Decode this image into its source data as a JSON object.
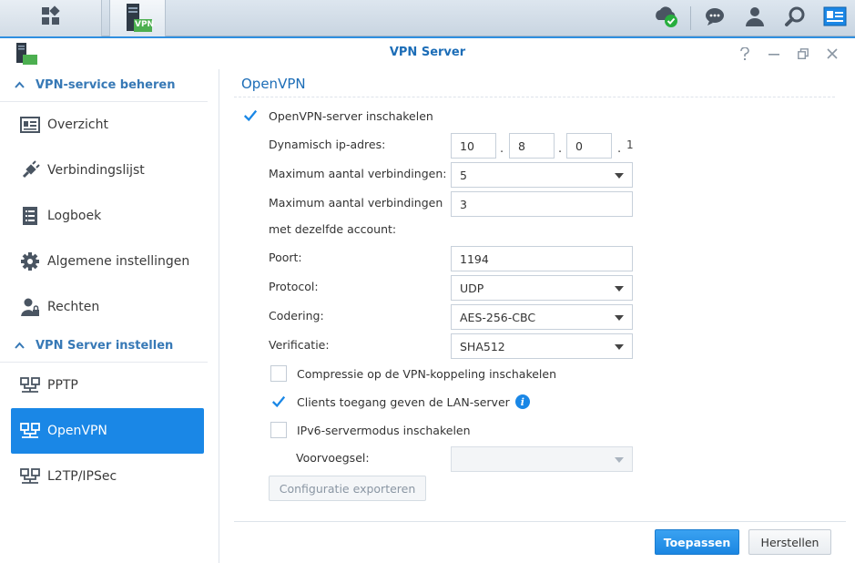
{
  "window": {
    "title": "VPN Server"
  },
  "taskbar": {
    "app_badge": "VPN"
  },
  "sidebar": {
    "groups": [
      {
        "label": "VPN-service beheren"
      },
      {
        "label": "VPN Server instellen"
      }
    ],
    "items": [
      {
        "label": "Overzicht"
      },
      {
        "label": "Verbindingslijst"
      },
      {
        "label": "Logboek"
      },
      {
        "label": "Algemene instellingen"
      },
      {
        "label": "Rechten"
      },
      {
        "label": "PPTP"
      },
      {
        "label": "OpenVPN"
      },
      {
        "label": "L2TP/IPSec"
      }
    ]
  },
  "main": {
    "title": "OpenVPN",
    "enable_label": "OpenVPN-server inschakelen",
    "dyn_ip_label": "Dynamisch ip-adres:",
    "ip": {
      "a": "10",
      "b": "8",
      "c": "0",
      "d": "1",
      "sep": "."
    },
    "max_conn_label": "Maximum aantal verbindingen:",
    "max_conn_value": "5",
    "max_same_label_1": "Maximum aantal verbindingen",
    "max_same_label_2": "met dezelfde account:",
    "max_same_value": "3",
    "port_label": "Poort:",
    "port_value": "1194",
    "protocol_label": "Protocol:",
    "protocol_value": "UDP",
    "encryption_label": "Codering:",
    "encryption_value": "AES-256-CBC",
    "auth_label": "Verificatie:",
    "auth_value": "SHA512",
    "compression_label": "Compressie op de VPN-koppeling inschakelen",
    "lan_label": "Clients toegang geven de LAN-server",
    "ipv6_label": "IPv6-servermodus inschakelen",
    "prefix_label": "Voorvoegsel:",
    "export_label": "Configuratie exporteren",
    "apply_label": "Toepassen",
    "reset_label": "Herstellen"
  },
  "colors": {
    "accent": "#1a87e6",
    "title": "#1c6db7",
    "check": "#1a87e6"
  }
}
